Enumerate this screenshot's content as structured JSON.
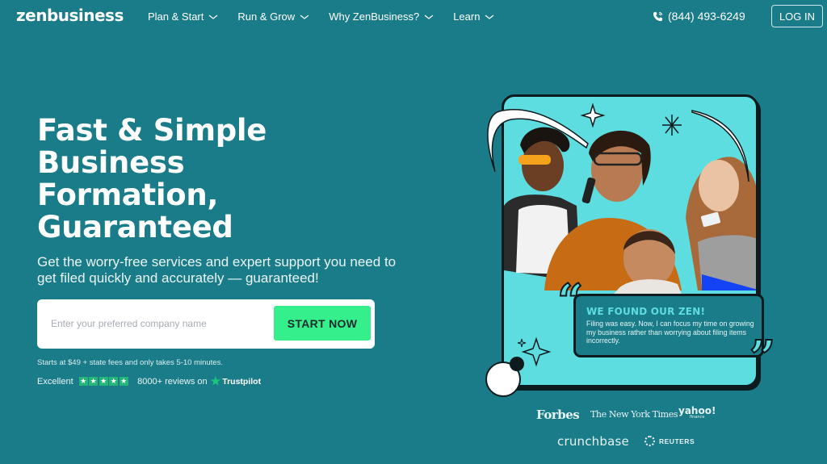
{
  "header": {
    "logo": "zenbusiness",
    "nav": [
      {
        "label": "Plan & Start"
      },
      {
        "label": "Run & Grow"
      },
      {
        "label": "Why ZenBusiness?"
      },
      {
        "label": "Learn"
      }
    ],
    "phone": "(844) 493-6249",
    "login_label": "LOG IN"
  },
  "hero": {
    "headline_lines": [
      "Fast & Simple",
      "Business",
      "Formation,",
      "Guaranteed"
    ],
    "subhead": "Get the worry-free services and expert support you need to get filed quickly and accurately — guaranteed!",
    "input_placeholder": "Enter your preferred company name",
    "input_value": "",
    "cta_label": "START NOW",
    "fineprint": "Starts at $49 + state fees and only takes 5-10 minutes.",
    "rating_label": "Excellent",
    "rating_stars": 5,
    "reviews_text": "8000+ reviews on",
    "reviews_brand": "Trustpilot"
  },
  "testimonial": {
    "title": "WE FOUND OUR ZEN!",
    "text": "Filing was easy. Now, I can focus my time on growing my business rather than worrying about filing items incorrectly."
  },
  "press": {
    "forbes": "Forbes",
    "nyt": "The New York Times",
    "yahoo": "yahoo!",
    "yahoo_sub": "finance",
    "crunchbase": "crunchbase",
    "reuters": "REUTERS"
  },
  "colors": {
    "background": "#1a7c88",
    "cta": "#34ef8c",
    "card_accent": "#5ddde0",
    "trustpilot_green": "#27b679"
  }
}
